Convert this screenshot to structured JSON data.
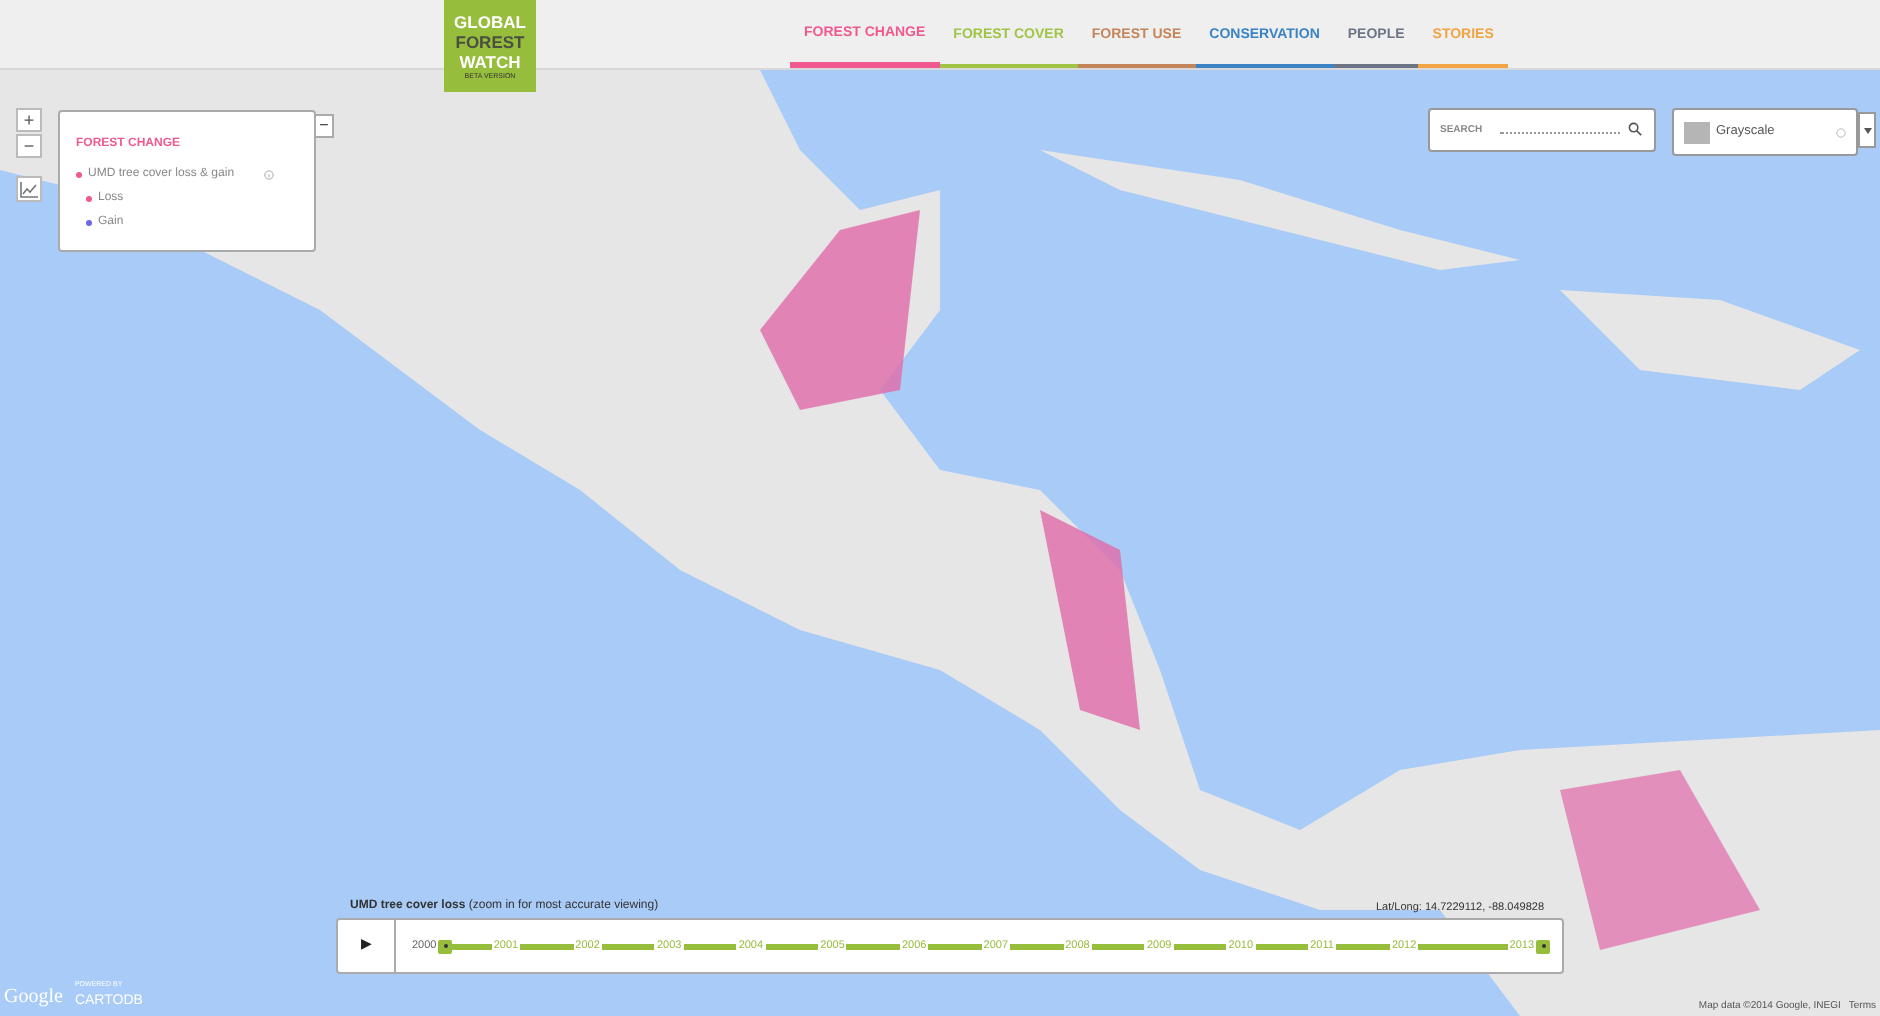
{
  "logo": {
    "lines": [
      "GLOBAL",
      "FOREST",
      "WATCH"
    ],
    "tagline": "BETA VERSION"
  },
  "nav": [
    {
      "label": "FOREST CHANGE",
      "color": "#f0598f",
      "selected": true
    },
    {
      "label": "FOREST COVER",
      "color": "#9fc446",
      "selected": false
    },
    {
      "label": "FOREST USE",
      "color": "#c4855a",
      "selected": false
    },
    {
      "label": "CONSERVATION",
      "color": "#3a83c4",
      "selected": false
    },
    {
      "label": "PEOPLE",
      "color": "#6b7585",
      "selected": false
    },
    {
      "label": "STORIES",
      "color": "#f0a444",
      "selected": false
    }
  ],
  "zoom_controls": [
    "+",
    "−"
  ],
  "legend": {
    "title": "FOREST CHANGE",
    "layer": "UMD tree cover loss & gain",
    "items": [
      {
        "label": "Loss",
        "color": "#f0598f"
      },
      {
        "label": "Gain",
        "color": "#6a6ae6"
      }
    ],
    "collapse": "−"
  },
  "search": {
    "placeholder": "SEARCH"
  },
  "basemap": {
    "label": "Grayscale"
  },
  "timeline": {
    "title": "UMD tree cover loss",
    "note": "(zoom in for most accurate viewing)",
    "play": "▶",
    "years": [
      "2000",
      "2001",
      "2002",
      "2003",
      "2004",
      "2005",
      "2006",
      "2007",
      "2008",
      "2009",
      "2010",
      "2011",
      "2012",
      "2013"
    ]
  },
  "coordinates": "Lat/Long: 14.7229112, -88.049828",
  "attribution": {
    "map_data": "Map data ©2014 Google, INEGI",
    "terms": "Terms"
  },
  "branding": {
    "google": "Google",
    "powered": "POWERED BY",
    "cartodb": "CARTODB"
  }
}
